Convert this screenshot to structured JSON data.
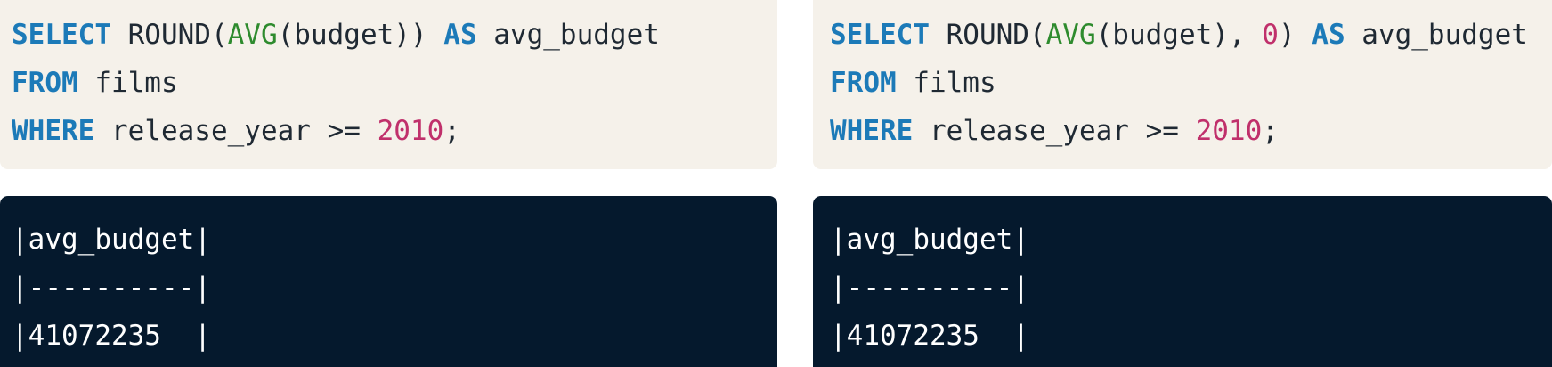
{
  "left": {
    "query": {
      "line1": [
        {
          "cls": "kw",
          "text": "SELECT"
        },
        {
          "cls": "plain",
          "text": " ROUND("
        },
        {
          "cls": "fn",
          "text": "AVG"
        },
        {
          "cls": "plain",
          "text": "(budget)) "
        },
        {
          "cls": "kw",
          "text": "AS"
        },
        {
          "cls": "plain",
          "text": " avg_budget"
        }
      ],
      "line2": [
        {
          "cls": "kw",
          "text": "FROM"
        },
        {
          "cls": "plain",
          "text": " films"
        }
      ],
      "line3": [
        {
          "cls": "kw",
          "text": "WHERE"
        },
        {
          "cls": "plain",
          "text": " release_year >= "
        },
        {
          "cls": "num",
          "text": "2010"
        },
        {
          "cls": "plain",
          "text": ";"
        }
      ]
    },
    "output": {
      "header": "|avg_budget|",
      "separator": "|----------|",
      "row": "|41072235  |"
    }
  },
  "right": {
    "query": {
      "line1": [
        {
          "cls": "kw",
          "text": "SELECT"
        },
        {
          "cls": "plain",
          "text": " ROUND("
        },
        {
          "cls": "fn",
          "text": "AVG"
        },
        {
          "cls": "plain",
          "text": "(budget), "
        },
        {
          "cls": "num",
          "text": "0"
        },
        {
          "cls": "plain",
          "text": ") "
        },
        {
          "cls": "kw",
          "text": "AS"
        },
        {
          "cls": "plain",
          "text": " avg_budget"
        }
      ],
      "line2": [
        {
          "cls": "kw",
          "text": "FROM"
        },
        {
          "cls": "plain",
          "text": " films"
        }
      ],
      "line3": [
        {
          "cls": "kw",
          "text": "WHERE"
        },
        {
          "cls": "plain",
          "text": " release_year >= "
        },
        {
          "cls": "num",
          "text": "2010"
        },
        {
          "cls": "plain",
          "text": ";"
        }
      ]
    },
    "output": {
      "header": "|avg_budget|",
      "separator": "|----------|",
      "row": "|41072235  |"
    }
  },
  "colors": {
    "code_background": "#f5f1ea",
    "output_background": "#05192d",
    "keyword": "#1c7ab8",
    "function": "#2e8b2e",
    "number": "#c0306b"
  }
}
